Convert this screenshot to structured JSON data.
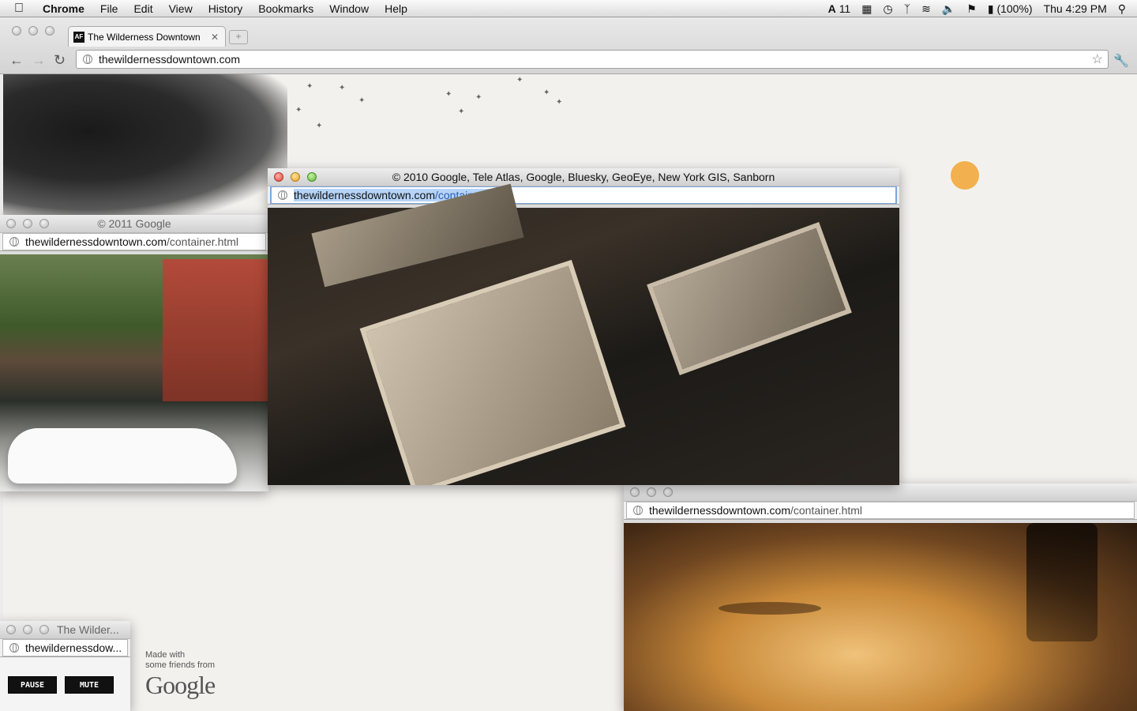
{
  "menubar": {
    "app": "Chrome",
    "menus": [
      "File",
      "Edit",
      "View",
      "History",
      "Bookmarks",
      "Window",
      "Help"
    ],
    "status": {
      "adobe_count": "11",
      "battery": "(100%)",
      "clock": "Thu 4:29 PM"
    }
  },
  "browser": {
    "tab_title": "The Wilderness Downtown",
    "tab_favicon": "AF",
    "url": "thewildernessdowntown.com"
  },
  "popups": {
    "street": {
      "title": "© 2011 Google",
      "host": "thewildernessdowntown.com",
      "path": "/container.html"
    },
    "aerial": {
      "title": "© 2010 Google, Tele Atlas, Google, Bluesky, GeoEye, New York GIS, Sanborn",
      "host": "thewildernessdowntown.com",
      "path": "/container.html"
    },
    "running": {
      "title": "",
      "host": "thewildernessdowntown.com",
      "path": "/container.html"
    },
    "small": {
      "title": "The Wilder...",
      "url": "thewildernessdow..."
    }
  },
  "controls": {
    "pause": "PAUSE",
    "mute": "MUTE"
  },
  "credit": {
    "line1": "Made with",
    "line2": "some friends from",
    "brand": "Google"
  },
  "colors": {
    "sun": "#f2a93c",
    "selection": "#b5d3f7",
    "page_background": "#f3f1ee"
  }
}
